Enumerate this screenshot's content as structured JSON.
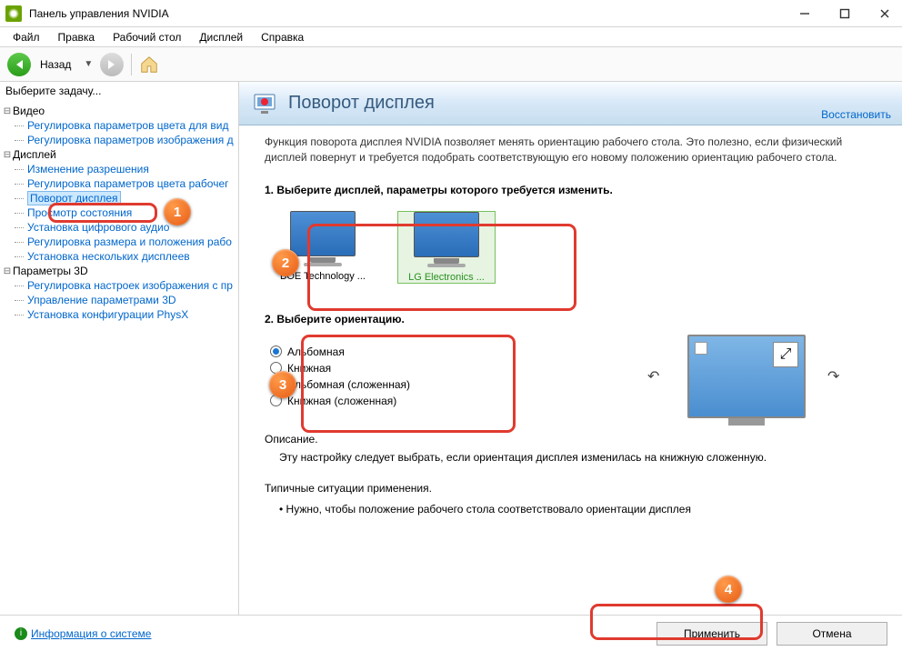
{
  "titlebar": {
    "title": "Панель управления NVIDIA"
  },
  "menubar": [
    "Файл",
    "Правка",
    "Рабочий стол",
    "Дисплей",
    "Справка"
  ],
  "toolbar": {
    "back": "Назад"
  },
  "sidebar": {
    "task_label": "Выберите задачу...",
    "groups": [
      {
        "label": "Видео",
        "items": [
          "Регулировка параметров цвета для вид",
          "Регулировка параметров изображения д"
        ]
      },
      {
        "label": "Дисплей",
        "items": [
          "Изменение разрешения",
          "Регулировка параметров цвета рабочег",
          "Поворот дисплея",
          "Просмотр состояния",
          "Установка цифрового аудио",
          "Регулировка размера и положения рабо",
          "Установка нескольких дисплеев"
        ],
        "selected_index": 2
      },
      {
        "label": "Параметры 3D",
        "items": [
          "Регулировка настроек изображения с пр",
          "Управление параметрами 3D",
          "Установка конфигурации PhysX"
        ]
      }
    ]
  },
  "main": {
    "title": "Поворот дисплея",
    "restore": "Восстановить",
    "intro": "Функция поворота дисплея NVIDIA позволяет менять ориентацию рабочего стола. Это полезно, если физический дисплей повернут и требуется подобрать соответствующую его новому положению ориентацию рабочего стола.",
    "step1": "1. Выберите дисплей, параметры которого требуется изменить.",
    "displays": [
      {
        "name": "BOE Technology ..."
      },
      {
        "name": "LG Electronics ..."
      }
    ],
    "selected_display": 1,
    "step2": "2. Выберите ориентацию.",
    "orientations": [
      "Альбомная",
      "Книжная",
      "Альбомная (сложенная)",
      "Книжная (сложенная)"
    ],
    "selected_orientation": 0,
    "desc_head": "Описание.",
    "desc_body": "Эту настройку следует выбрать, если ориентация дисплея изменилась на книжную сложенную.",
    "situations_head": "Типичные ситуации применения.",
    "situation1": "Нужно, чтобы положение рабочего стола соответствовало ориентации дисплея"
  },
  "footer": {
    "sysinfo": "Информация о системе",
    "apply": "Применить",
    "cancel": "Отмена"
  }
}
